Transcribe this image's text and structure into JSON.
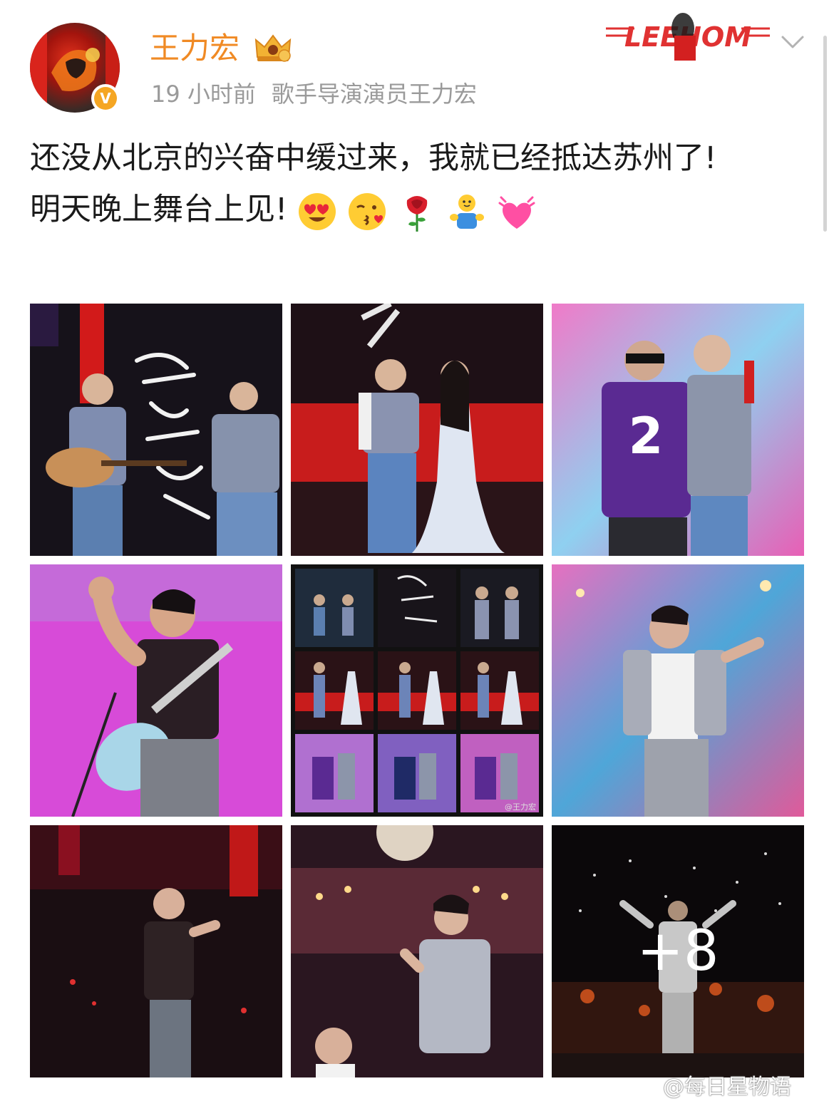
{
  "post": {
    "author": "王力宏",
    "time": "19 小时前",
    "source": "歌手导演演员王力宏",
    "verified_badge": "V",
    "text_line1": "还没从北京的兴奋中缓过来，我就已经抵达苏州了!",
    "text_line2": "明天晚上舞台上见!",
    "emojis": [
      "heart-eyes-icon",
      "kiss-icon",
      "rose-icon",
      "hug-icon",
      "pink-hearts-icon"
    ]
  },
  "banner": {
    "text": "LEEHOM"
  },
  "photos": {
    "more_count": "+8",
    "collage_watermark": "@王力宏"
  },
  "footer": {
    "watermark": "@每日星物语"
  },
  "colors": {
    "username": "#f08a24",
    "meta": "#9a9a9a",
    "text": "#1a1a1a",
    "verified": "#f5a623"
  }
}
